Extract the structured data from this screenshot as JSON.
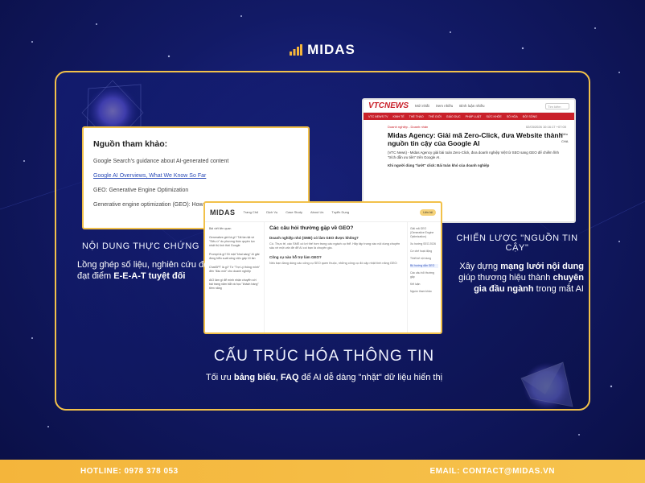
{
  "brand": {
    "logo_text": "MIDAS"
  },
  "left_card": {
    "title": "Nguồn tham khảo:",
    "references": [
      "Google Search's guidance about AI-generated content",
      "Google AI Overviews, What We Know So Far",
      "GEO: Generative Engine Optimization",
      "Generative engine optimization (GEO): How"
    ]
  },
  "right_card": {
    "logo": "VTCNEWS",
    "top_links": [
      "Mới nhất",
      "Xem nhiều",
      "Bình luận nhiều"
    ],
    "search_placeholder": "Tìm kiếm",
    "nav": [
      "VTC NEWS TV",
      "KINH TẾ",
      "THỂ THAO",
      "THẾ GIỚI",
      "GIÁO DỤC",
      "PHÁP LUẬT",
      "SỨC KHỎE",
      "SỐ HÓA",
      "ĐỜI SỐNG"
    ],
    "category": "Doanh nghiệp - Doanh nhân",
    "date": "02/03/2026 10:16:17 +07:00",
    "headline": "Midas Agency: Giải mã Zero-Click, đưa Website thành nguồn tin cậy của Google AI",
    "summary": "(VTC News) - Midas Agency giải bài toán Zero-Click, đưa doanh nghiệp Việt từ SEO sang GEO để chiếm lĩnh \"trích dẫn ưu tiên\" trên Google AI.",
    "subhead": "Khi người dùng \"lướt\" click: Bài toán khó của doanh nghiệp",
    "side_text": "Siêu CHA"
  },
  "center_card": {
    "logo": "MIDAS",
    "nav": [
      "Trang Chủ",
      "Dịch Vụ",
      "Case Study",
      "About Us",
      "Tuyển Dụng"
    ],
    "cta": "Liên hệ",
    "left_items": [
      "Bài viết liên quan",
      "Generative giới là gì? Tất tần tật về \"Siêu ứ\" du phương thức quyền lực nhất thị tính thời Google",
      "Prompt là gì? Bí mật \"khai sáng\" AI giải đúng hiểu suất công việc gấp 10 lần",
      "ChatGPT là gì? Từ \"Trợ Lý thông minh\" đến \"đầu mối\" cho doanh nghiệp",
      "AIO làm gì để mình nhận chuyển với bài trang năm bắt và học \"khách hàng\" tiềm năng"
    ],
    "heading": "Các câu hỏi thường gặp về GEO?",
    "faq": [
      {
        "q": "Doanh nghiệp nhỏ (SME) có làm GEO được không?",
        "a": "Có. Thực tế, các SME có lợi thế hơn trong các ngách cụ thể. Hãy tập trung vào nội dung chuyên sâu về một vấn đề để AI coi bạn là chuyên gia."
      },
      {
        "q": "Công cụ nào hỗ trợ làm GEO?",
        "a": "Nếu bạn đang dùng các công cụ SEO quen thuộc, những công cụ đó cập nhật tính năng GEO:"
      }
    ],
    "right_items": [
      "Giải mã GEO (Generative Engine Optimization)",
      "Xu hướng SEO 2026",
      "Cơ chế hoạt động",
      "Thiết kế nội dung",
      "Bộ hướng dẫn GEO",
      "Các câu hỏi thường gặp",
      "Kết luận",
      "Nguồn tham khảo"
    ]
  },
  "captions": {
    "left_title": "NỘI DUNG THỰC CHỨNG",
    "left_body_pre": "Lồng ghép số liệu, nghiên cứu để đạt điểm ",
    "left_body_bold": "E-E-A-T tuyệt đối",
    "right_title": "CHIẾN LƯỢC \"NGUỒN TIN CẬY\"",
    "right_body_1": "Xây dựng ",
    "right_body_b1": "mạng lưới nội dung",
    "right_body_2": " giúp thương hiệu thành ",
    "right_body_b2": "chuyên gia đầu ngành",
    "right_body_3": " trong mắt AI",
    "center_title": "CẤU TRÚC HÓA THÔNG TIN",
    "center_body_1": "Tối ưu ",
    "center_body_b1": "bảng biểu",
    "center_body_2": ", ",
    "center_body_b2": "FAQ",
    "center_body_3": " để AI dễ dàng \"nhặt\" dữ liệu hiển thị"
  },
  "footer": {
    "hotline": "HOTLINE: 0978 378 053",
    "email": "EMAIL: CONTACT@MIDAS.VN"
  },
  "colors": {
    "accent": "#f2c14a",
    "background": "#121a66",
    "footer": "#f4b53b"
  }
}
